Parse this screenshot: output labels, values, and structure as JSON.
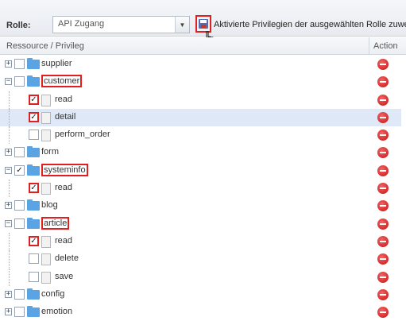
{
  "toolbar": {
    "role_label": "Rolle:",
    "role_value": "API Zugang",
    "hint": "Aktivierte Privilegien der ausgewählten Rolle zuweisen"
  },
  "grid": {
    "col_resource": "Ressource / Privileg",
    "col_action": "Action"
  },
  "rows": [
    {
      "label": "supplier",
      "type": "resource",
      "expanded": false,
      "checked": false
    },
    {
      "label": "customer",
      "type": "resource",
      "expanded": true,
      "checked": false,
      "highlight": true
    },
    {
      "label": "read",
      "type": "privilege",
      "checked": true,
      "highlight_cb": true
    },
    {
      "label": "detail",
      "type": "privilege",
      "checked": true,
      "highlight_cb": true,
      "selected": true
    },
    {
      "label": "perform_order",
      "type": "privilege",
      "checked": false
    },
    {
      "label": "form",
      "type": "resource",
      "expanded": false,
      "checked": false
    },
    {
      "label": "systeminfo",
      "type": "resource",
      "expanded": true,
      "checked": true,
      "highlight": true
    },
    {
      "label": "read",
      "type": "privilege",
      "checked": true,
      "highlight_cb": true
    },
    {
      "label": "blog",
      "type": "resource",
      "expanded": false,
      "checked": false
    },
    {
      "label": "article",
      "type": "resource",
      "expanded": true,
      "checked": false,
      "highlight": true
    },
    {
      "label": "read",
      "type": "privilege",
      "checked": true,
      "highlight_cb": true
    },
    {
      "label": "delete",
      "type": "privilege",
      "checked": false
    },
    {
      "label": "save",
      "type": "privilege",
      "checked": false
    },
    {
      "label": "config",
      "type": "resource",
      "expanded": false,
      "checked": false
    },
    {
      "label": "emotion",
      "type": "resource",
      "expanded": false,
      "checked": false
    }
  ]
}
